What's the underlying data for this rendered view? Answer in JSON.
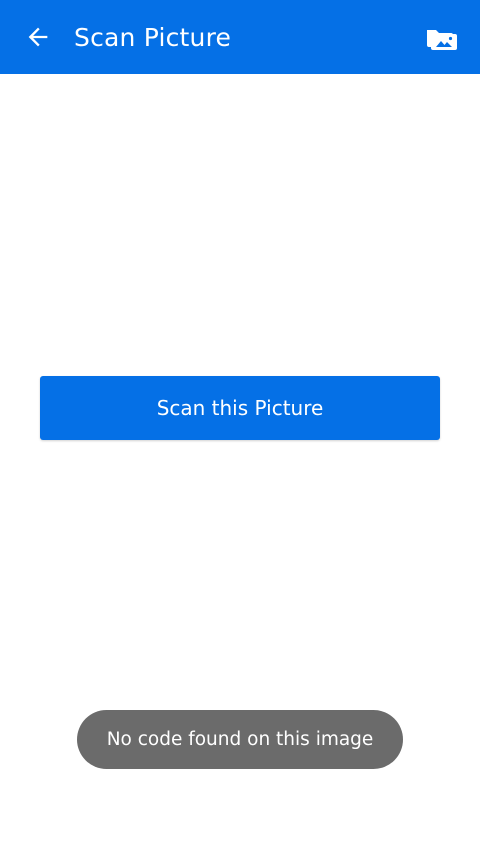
{
  "app_bar": {
    "title": "Scan Picture",
    "back_icon": "arrow-left-icon",
    "gallery_icon": "photo-folder-icon",
    "background": "#0570E6"
  },
  "main": {
    "scan_button_label": "Scan this Picture",
    "button_color": "#0570E6"
  },
  "toast": {
    "message": "No code found on this image",
    "background": "#6b6b6b"
  }
}
